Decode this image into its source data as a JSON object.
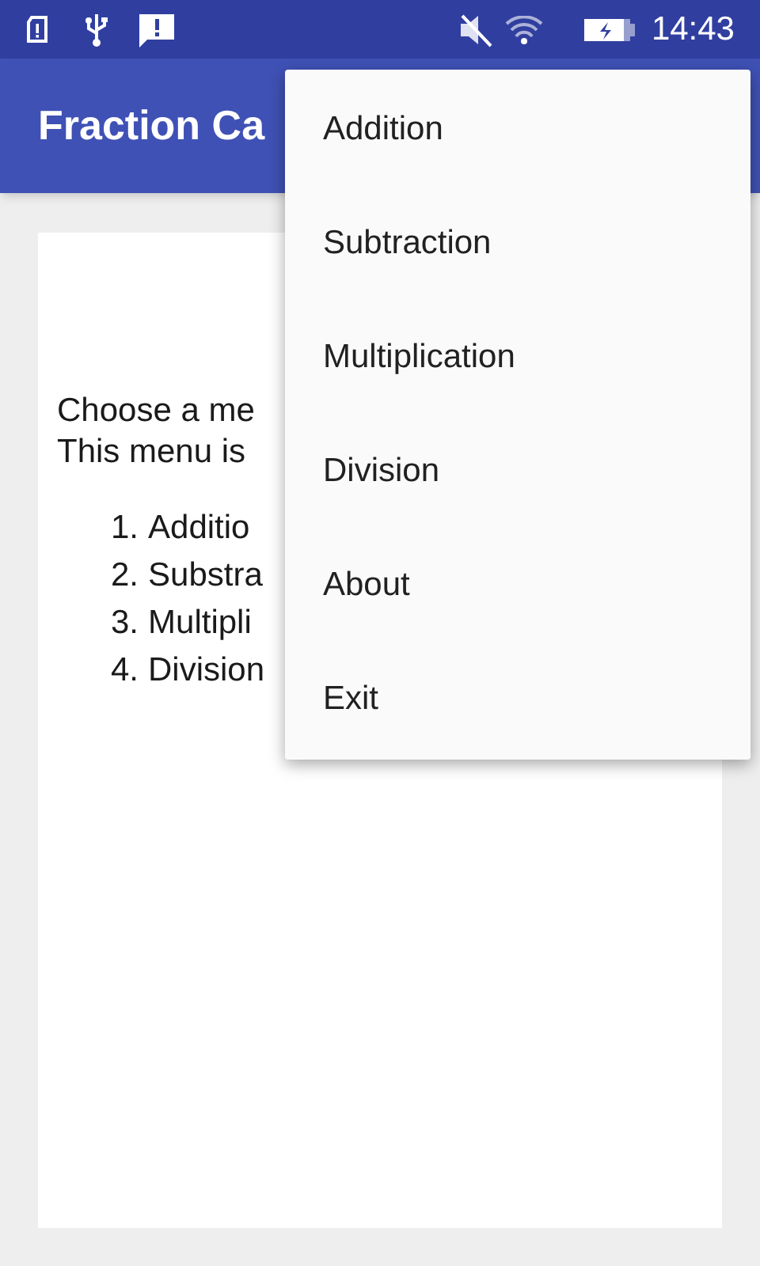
{
  "status_bar": {
    "time": "14:43"
  },
  "app_bar": {
    "title": "Fraction Ca"
  },
  "content": {
    "intro_lines": [
      "Choose a me",
      "This menu is"
    ],
    "list": [
      {
        "number": "1.",
        "label": "Additio"
      },
      {
        "number": "2.",
        "label": "Substra"
      },
      {
        "number": "3.",
        "label": "Multipli"
      },
      {
        "number": "4.",
        "label": "Division"
      }
    ]
  },
  "overflow_menu": {
    "items": [
      {
        "label": "Addition"
      },
      {
        "label": "Subtraction"
      },
      {
        "label": "Multiplication"
      },
      {
        "label": "Division"
      },
      {
        "label": "About"
      },
      {
        "label": "Exit"
      }
    ]
  }
}
